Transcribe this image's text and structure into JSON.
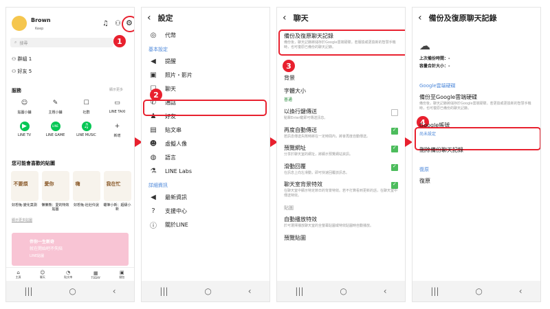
{
  "panel1": {
    "profile_name": "Brown",
    "profile_status": "Keep",
    "search_placeholder": "搜尋",
    "groups_label": "群組 1",
    "friends_label": "好友 5",
    "services_title": "服務",
    "see_more": "顯示更多",
    "services": [
      {
        "label": "貼圖小舖",
        "icon": "smiley-icon"
      },
      {
        "label": "主題小舖",
        "icon": "brush-icon"
      },
      {
        "label": "社群",
        "icon": "chat-icon"
      },
      {
        "label": "LINE TAXI",
        "icon": "taxi-icon"
      },
      {
        "label": "LINE TV",
        "icon": "play-icon"
      },
      {
        "label": "LINE GAME",
        "icon": "game-icon"
      },
      {
        "label": "LINE MUSIC",
        "icon": "music-icon"
      },
      {
        "label": "新增",
        "icon": "plus-icon"
      }
    ],
    "stickers_title": "您可能會喜歡的貼圖",
    "stickers": [
      {
        "label": "好想兔-變化莫測",
        "art": "不要煩"
      },
      {
        "label": "懶懶熊：愛的特效貼圖",
        "art": "愛你"
      },
      {
        "label": "好想兔-壯壯伶說",
        "art": "嗨"
      },
      {
        "label": "蠟筆小新：超級小新",
        "art": "我在忙"
      }
    ],
    "hide_link": "顯示更多貼圖",
    "promo_line1": "伴你一生新奇",
    "promo_line2": "就在開始吧不失陪",
    "promo_tag": "LINE貼圖",
    "tabs": [
      "主頁",
      "聊天",
      "貼文串",
      "TODAY",
      "錢包"
    ],
    "step": "1"
  },
  "panel2": {
    "title": "設定",
    "items_top": [
      {
        "label": "代幣",
        "icon": "coin-icon"
      }
    ],
    "section_basic": "基本設定",
    "items_basic": [
      {
        "label": "提醒",
        "icon": "speaker-icon"
      },
      {
        "label": "照片・影片",
        "icon": "photo-icon"
      },
      {
        "label": "聊天",
        "icon": "chat-icon"
      },
      {
        "label": "通話",
        "icon": "phone-icon"
      },
      {
        "label": "好友",
        "icon": "friend-icon"
      },
      {
        "label": "貼文串",
        "icon": "timeline-icon"
      },
      {
        "label": "虛擬人像",
        "icon": "avatar-icon"
      },
      {
        "label": "語言",
        "icon": "globe-icon"
      },
      {
        "label": "LINE Labs",
        "icon": "flask-icon"
      }
    ],
    "section_info": "詳細資訊",
    "items_info": [
      {
        "label": "最新資訊",
        "icon": "megaphone-icon"
      },
      {
        "label": "支援中心",
        "icon": "help-icon"
      },
      {
        "label": "關於LINE",
        "icon": "info-icon"
      }
    ],
    "step": "2"
  },
  "panel3": {
    "title": "聊天",
    "backup_title": "備份及復原聊天記錄",
    "backup_desc": "備份後，聊天記錄將儲存於Google雲端硬碟。若服換或更換新的智慧手機時，也可復原已備份的聊天記錄。",
    "section_label": "顯示",
    "step": "3",
    "items": [
      {
        "title": "背景",
        "desc": "",
        "sub": "",
        "cb": ""
      },
      {
        "title": "字體大小",
        "desc": "",
        "sub": "普通",
        "cb": ""
      },
      {
        "title": "以換行鍵傳送",
        "desc": "點擊Enter鍵即可傳送訊息。",
        "sub": "",
        "cb": "off"
      },
      {
        "title": "再度自動傳送",
        "desc": "若訊息傳送失敗時將在一定時間內，將會再度自動傳送。",
        "sub": "",
        "cb": "on"
      },
      {
        "title": "預覽網址",
        "desc": "分享於聊天室的網址，將顯示預覽網站資訊。",
        "sub": "",
        "cb": "on"
      },
      {
        "title": "滑動回覆",
        "desc": "在訊息上向左滑動，即可快速回覆該訊息。",
        "sub": "",
        "cb": "on"
      },
      {
        "title": "聊天室背景特效",
        "desc": "在聊天室中顯示特定節日的背景特效。若不打算看到更新的話，在聊天室中傳送特效。",
        "sub": "",
        "cb": "on"
      }
    ],
    "section2": "貼圖",
    "items2": [
      {
        "title": "自動播放特效",
        "desc": "於可選擇播放聊天室的全螢幕貼圖或特效貼圖時自動播放。"
      },
      {
        "title": "預覽貼圖",
        "desc": ""
      }
    ]
  },
  "panel4": {
    "title": "備份及復原聊天記錄",
    "last_backup_label": "上次備份時間：-",
    "total_size_label": "容量合計大小：-",
    "section_google": "Google雲端硬碟",
    "backup_title": "備份至Google雲端硬碟",
    "backup_desc": "備份後，聊天記錄將儲存於Google雲端硬碟。若更換或更換新的智慧手機時，也可復原已備份的聊天記錄。",
    "account_title": "Google帳號",
    "account_value": "尚未設定",
    "delete_title": "刪除備份聊天記錄",
    "section_restore": "復原",
    "restore_title": "復原",
    "step": "4"
  },
  "colors": {
    "accent_red": "#e8202e",
    "line_green": "#06c755",
    "section_blue": "#4a86d9"
  }
}
